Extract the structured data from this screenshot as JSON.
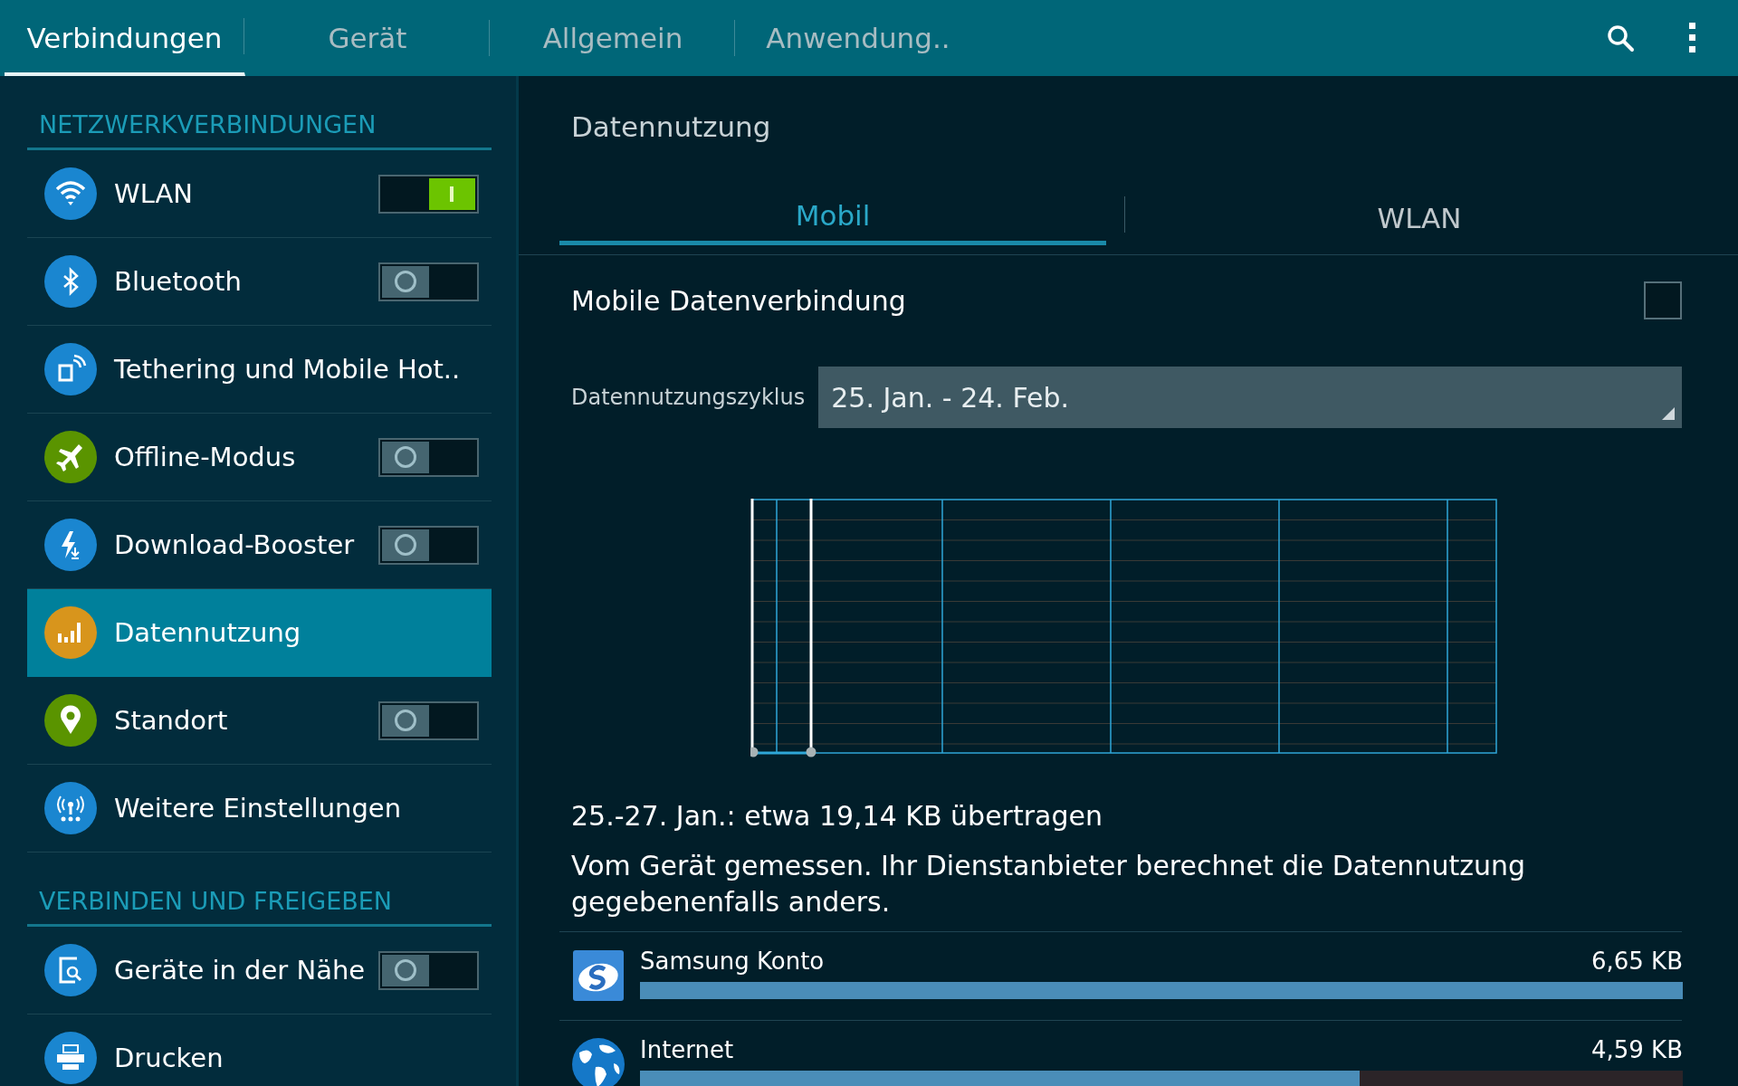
{
  "top_tabs": [
    {
      "label": "Verbindungen",
      "selected": true
    },
    {
      "label": "Gerät",
      "selected": false
    },
    {
      "label": "Allgemein",
      "selected": false
    },
    {
      "label": "Anwendung..",
      "selected": false
    }
  ],
  "sidebar": {
    "sections": [
      {
        "title": "NETZWERKVERBINDUNGEN",
        "items": [
          {
            "label": "WLAN",
            "kind": "switch",
            "on": true,
            "selected": false,
            "color": "#1a86d0"
          },
          {
            "label": "Bluetooth",
            "kind": "switch",
            "on": false,
            "selected": false,
            "color": "#1a86d0"
          },
          {
            "label": "Tethering und Mobile Hot..",
            "kind": "link",
            "selected": false,
            "color": "#1a86d0"
          },
          {
            "label": "Offline-Modus",
            "kind": "switch",
            "on": false,
            "selected": false,
            "color": "#5a9400"
          },
          {
            "label": "Download-Booster",
            "kind": "switch",
            "on": false,
            "selected": false,
            "color": "#1a86d0"
          },
          {
            "label": "Datennutzung",
            "kind": "link",
            "selected": true,
            "color": "#d8951c"
          },
          {
            "label": "Standort",
            "kind": "switch",
            "on": false,
            "selected": false,
            "color": "#5a9400"
          },
          {
            "label": "Weitere Einstellungen",
            "kind": "link",
            "selected": false,
            "color": "#1a86d0"
          }
        ]
      },
      {
        "title": "VERBINDEN UND FREIGEBEN",
        "items": [
          {
            "label": "Geräte in der Nähe",
            "kind": "switch",
            "on": false,
            "selected": false,
            "color": "#1a86d0"
          },
          {
            "label": "Drucken",
            "kind": "link",
            "selected": false,
            "color": "#1a86d0"
          }
        ]
      }
    ]
  },
  "detail": {
    "title": "Datennutzung",
    "tabs": [
      {
        "label": "Mobil",
        "selected": true
      },
      {
        "label": "WLAN",
        "selected": false
      }
    ],
    "mobile_data": {
      "label": "Mobile Datenverbindung",
      "checked": false
    },
    "cycle": {
      "label": "Datennutzungszyklus",
      "value": "25. Jan. - 24. Feb."
    },
    "summary": "25.-27. Jan.: etwa 19,14 KB übertragen",
    "note": "Vom Gerät gemessen. Ihr Dienstanbieter berechnet die Datennutzung gegebenenfalls anders.",
    "apps": [
      {
        "name": "Samsung Konto",
        "amount": "6,65 KB",
        "level": 1
      },
      {
        "name": "Internet",
        "amount": "4,59 KB",
        "level": 0.69
      }
    ]
  }
}
